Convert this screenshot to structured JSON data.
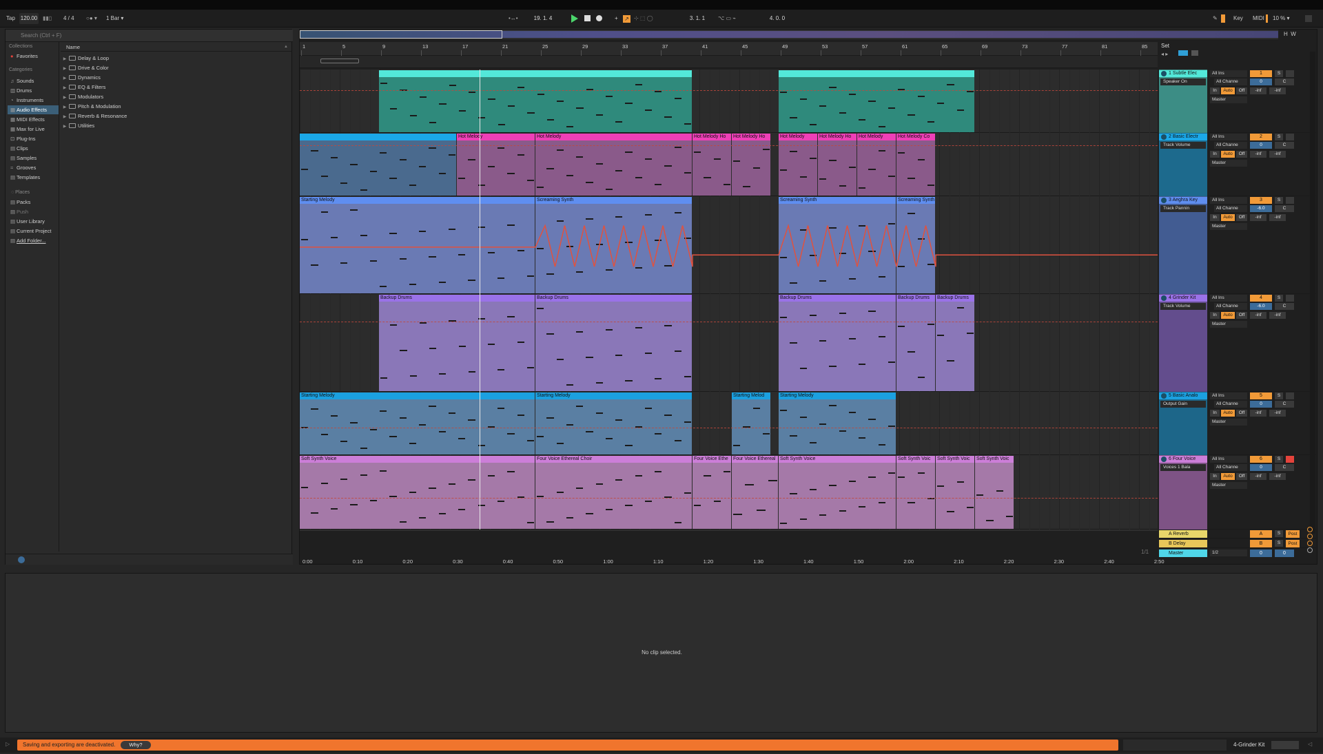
{
  "control_bar": {
    "tap": "Tap",
    "tempo": "120.00",
    "time_signature": "4 / 4",
    "quantize": "1 Bar",
    "position": "19.  1.  4",
    "loop_start": "3.  1.  1",
    "loop_length": "4.  0.  0",
    "key_label": "Key",
    "midi_label": "MIDI",
    "cpu": "10 %",
    "h_btn": "H",
    "w_btn": "W",
    "colors": {
      "accent": "#f19a38",
      "play": "#4bd56b"
    }
  },
  "browser": {
    "search_placeholder": "Search (Ctrl + F)",
    "collections_header": "Collections",
    "favorites": "Favorites",
    "categories_header": "Categories",
    "categories": [
      "Sounds",
      "Drums",
      "Instruments",
      "Audio Effects",
      "MIDI Effects",
      "Max for Live",
      "Plug-Ins",
      "Clips",
      "Samples",
      "Grooves",
      "Templates"
    ],
    "selected_category": "Audio Effects",
    "places_header": "Places",
    "places": [
      "Packs",
      "Push",
      "User Library",
      "Current Project",
      "Add Folder..."
    ],
    "name_header": "Name",
    "items": [
      "Delay & Loop",
      "Drive & Color",
      "Dynamics",
      "EQ & Filters",
      "Modulators",
      "Pitch & Modulation",
      "Reverb & Resonance",
      "Utilities"
    ]
  },
  "arrangement": {
    "set_label": "Set",
    "bar_markers": [
      "1",
      "5",
      "9",
      "13",
      "17",
      "21",
      "25",
      "29",
      "33",
      "37",
      "41",
      "45",
      "49",
      "53",
      "57",
      "61",
      "65",
      "69",
      "73",
      "77",
      "81",
      "85"
    ],
    "time_markers": [
      "0:00",
      "0:10",
      "0:20",
      "0:30",
      "0:40",
      "0:50",
      "1:00",
      "1:10",
      "1:20",
      "1:30",
      "1:40",
      "1:50",
      "2:00",
      "2:10",
      "2:20",
      "2:30",
      "2:40",
      "2:50"
    ],
    "page_indicator": "1/1",
    "clips": {
      "t2": [
        "Hot Melody",
        "Hot Melody",
        "Hot Melody Ho",
        "Hot Melody Ho",
        "Hot Melody",
        "Hot Melody Ho",
        "Hot Melody",
        "Hot Melody Co"
      ],
      "t3": [
        "Starting Melody",
        "Screaming Synth",
        "Screaming Synth",
        "Screaming Synth"
      ],
      "t4": [
        "Backup Drums",
        "Backup Drums",
        "Backup Drums",
        "Backup Drums",
        "Backup Drums"
      ],
      "t5": [
        "Starting Melody",
        "Starting Melody",
        "Starting Melod",
        "Starting Melody"
      ],
      "t6": [
        "Soft Synth Voice",
        "Four Voice Ethereal Choir",
        "Four Voice Ethe",
        "Four Voice Ethereal",
        "Soft Synth Voice",
        "Soft Synth Voic",
        "Soft Synth Voic",
        "Soft Synth Voic"
      ]
    }
  },
  "tracks": [
    {
      "name": "1 Subtle Elec",
      "device": "Speaker On",
      "input": "All Ins",
      "channel": "All Channe",
      "output": "Master",
      "number": "1",
      "volume": "0",
      "pan": "C",
      "sends": [
        "-inf",
        "-inf"
      ],
      "color": "#53e8d9"
    },
    {
      "name": "2 Basic Electr",
      "device": "Track Volume",
      "input": "All Ins",
      "channel": "All Channe",
      "output": "Master",
      "number": "2",
      "volume": "0",
      "pan": "C",
      "sends": [
        "-inf",
        "-inf"
      ],
      "color": "#1ba8e8"
    },
    {
      "name": "3 Aeghra Key",
      "device": "Track Pannin",
      "input": "All Ins",
      "channel": "All Channe",
      "output": "Master",
      "number": "3",
      "volume": "-6.0",
      "pan": "C",
      "sends": [
        "-inf",
        "-inf"
      ],
      "color": "#5f8ef0"
    },
    {
      "name": "4 Grinder Kit",
      "device": "Track Volume",
      "input": "All Ins",
      "channel": "All Channe",
      "output": "Master",
      "number": "4",
      "volume": "-6.0",
      "pan": "C",
      "sends": [
        "-inf",
        "-inf"
      ],
      "color": "#9a72e8"
    },
    {
      "name": "5 Basic Analo",
      "device": "Output Gain",
      "input": "All Ins",
      "channel": "All Channe",
      "output": "Master",
      "number": "5",
      "volume": "0",
      "pan": "C",
      "sends": [
        "-inf",
        "-inf"
      ],
      "color": "#1ba0e0"
    },
    {
      "name": "6 Four Voice",
      "device": "Voices 1 Bala",
      "input": "All Ins",
      "channel": "All Channe",
      "output": "Master",
      "number": "6",
      "volume": "0",
      "pan": "C",
      "sends": [
        "-inf",
        "-inf"
      ],
      "color": "#cc7ed8"
    }
  ],
  "monitor": {
    "in": "In",
    "auto": "Auto",
    "off": "Off"
  },
  "returns": [
    {
      "name": "A Reverb",
      "letter": "A",
      "color": "#e8d66a"
    },
    {
      "name": "B Delay",
      "letter": "B",
      "color": "#e8c75a"
    }
  ],
  "master": {
    "name": "Master",
    "output": "1/2",
    "volume": "0",
    "pan": "0"
  },
  "solo_label": "S",
  "post_label": "Post",
  "detail": {
    "message": "No clip selected."
  },
  "status_bar": {
    "warning": "Saving and exporting are deactivated.",
    "why_button": "Why?",
    "selected_track": "4-Grinder Kit"
  }
}
